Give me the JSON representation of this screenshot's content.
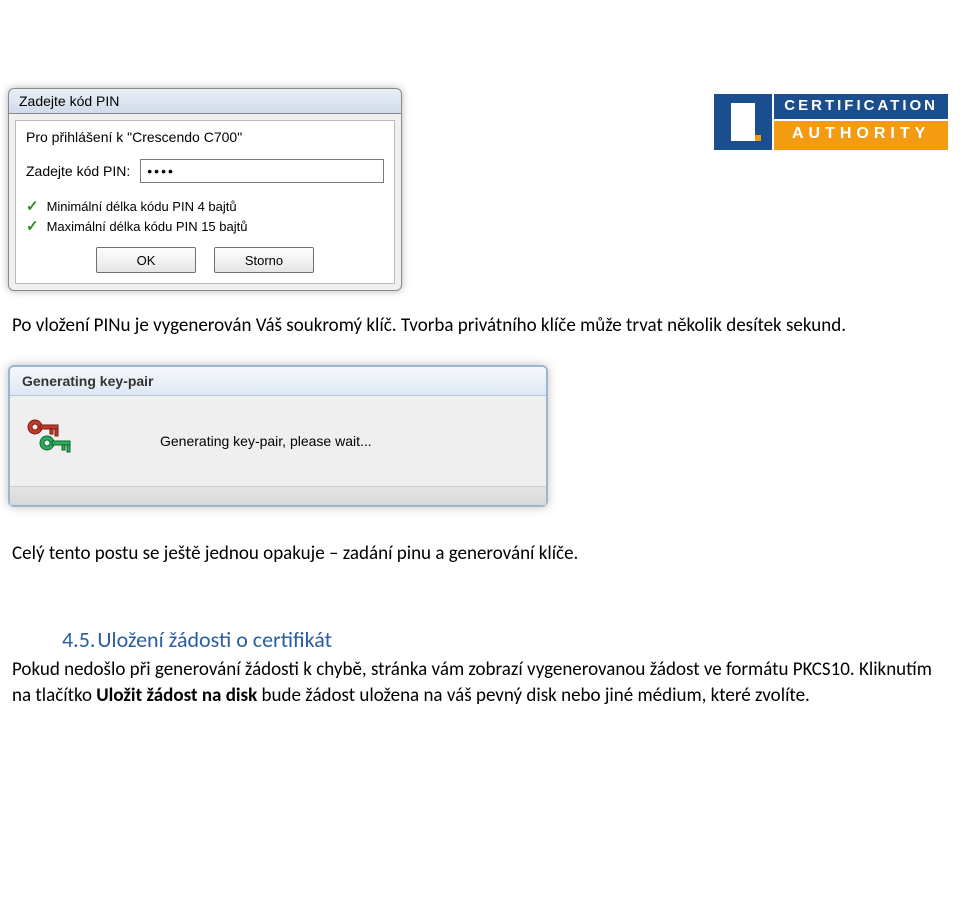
{
  "logo": {
    "line1": "CERTIFICATION",
    "line2": "AUTHORITY"
  },
  "dialog_pin": {
    "title": "Zadejte kód PIN",
    "prompt": "Pro přihlášení k \"Crescendo C700\"",
    "input_label": "Zadejte kód PIN:",
    "input_value": "••••",
    "rule_min": "Minimální délka kódu PIN 4 bajtů",
    "rule_max": "Maximální délka kódu PIN 15 bajtů",
    "btn_ok": "OK",
    "btn_cancel": "Storno"
  },
  "para1": "Po vložení PINu je vygenerován Váš soukromý klíč. Tvorba privátního klíče může trvat několik desítek sekund.",
  "dialog_gen": {
    "title": "Generating key-pair",
    "text": "Generating key-pair, please wait..."
  },
  "para2": "Celý tento postu se ještě jednou opakuje – zadání pinu a generování klíče.",
  "section": {
    "num": "4.5.",
    "title": "Uložení žádosti o certifikát"
  },
  "para3_a": "Pokud nedošlo při generování žádosti k chybě, stránka vám zobrazí vygenerovanou žádost ve formátu PKCS10. Kliknutím na tlačítko ",
  "para3_bold": "Uložit žádost na disk",
  "para3_b": " bude žádost uložena na váš pevný disk nebo jiné médium, které zvolíte."
}
